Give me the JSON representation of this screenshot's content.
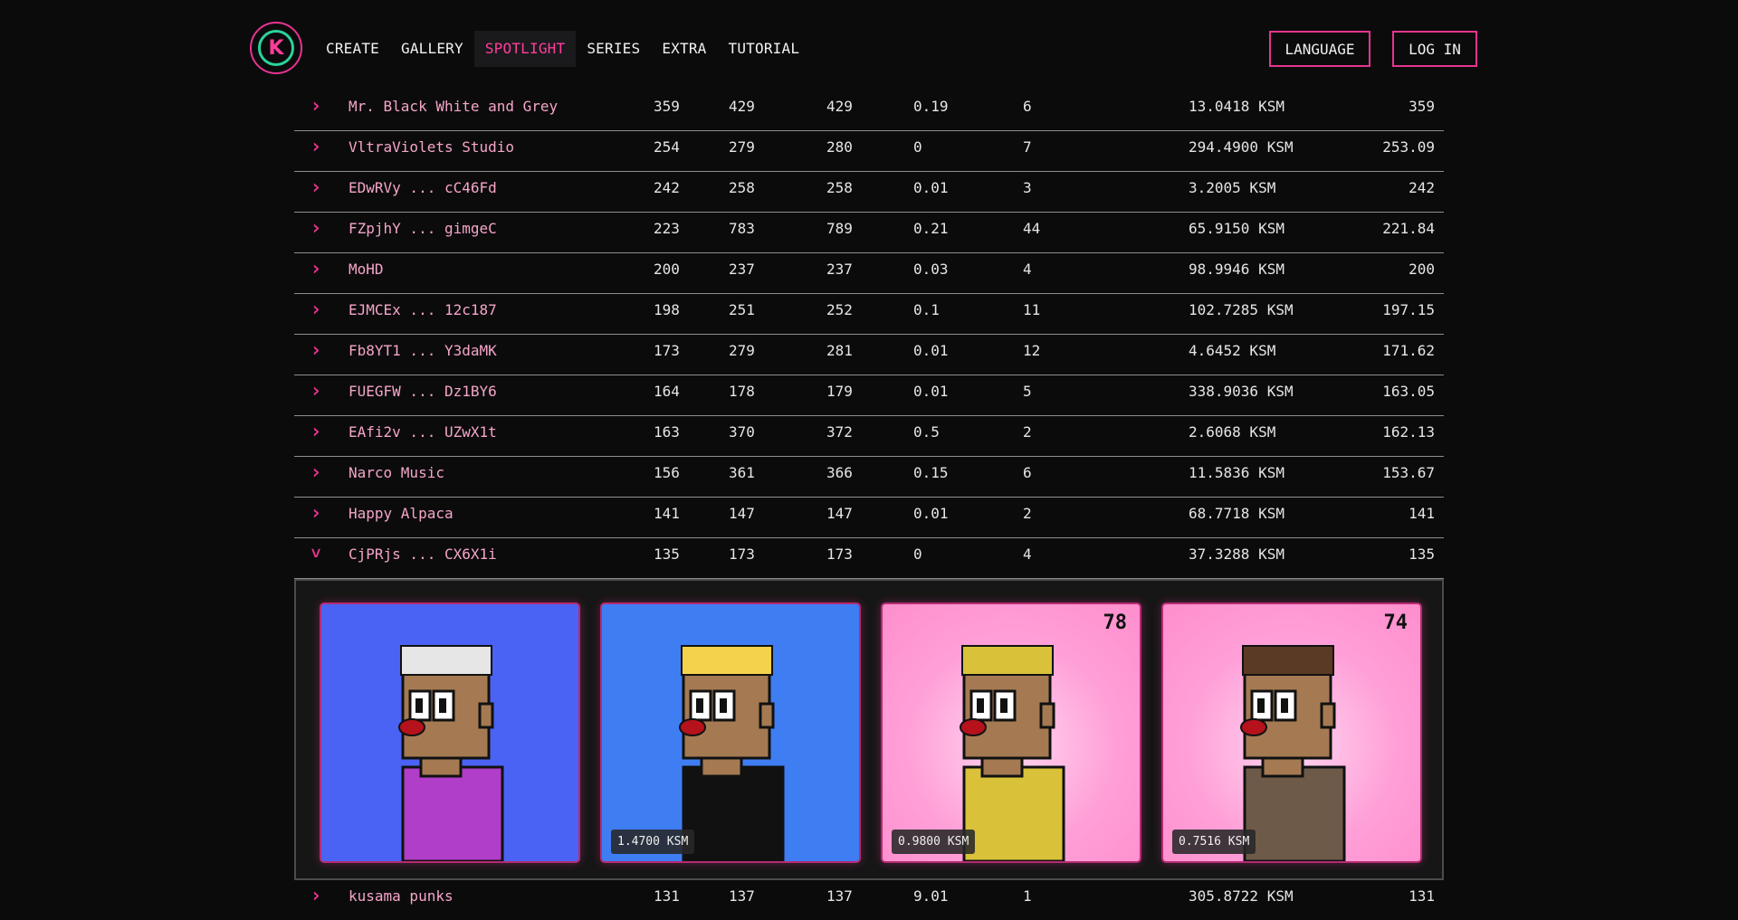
{
  "header": {
    "logo_letter": "K",
    "nav": [
      {
        "label": "CREATE",
        "active": false
      },
      {
        "label": "GALLERY",
        "active": false
      },
      {
        "label": "SPOTLIGHT",
        "active": true
      },
      {
        "label": "SERIES",
        "active": false
      },
      {
        "label": "EXTRA",
        "active": false
      },
      {
        "label": "TUTORIAL",
        "active": false
      }
    ],
    "language_label": "LANGUAGE",
    "login_label": "LOG IN"
  },
  "rows": [
    {
      "name": "Mr. Black White and Grey",
      "a": "359",
      "b": "429",
      "c": "429",
      "d": "0.19",
      "e": "6",
      "f": "13.0418 KSM",
      "g": "359",
      "expanded": false
    },
    {
      "name": "VltraViolets Studio",
      "a": "254",
      "b": "279",
      "c": "280",
      "d": "0",
      "e": "7",
      "f": "294.4900 KSM",
      "g": "253.09",
      "expanded": false
    },
    {
      "name": "EDwRVy ... cC46Fd",
      "a": "242",
      "b": "258",
      "c": "258",
      "d": "0.01",
      "e": "3",
      "f": "3.2005 KSM",
      "g": "242",
      "expanded": false
    },
    {
      "name": "FZpjhY ... gimgeC",
      "a": "223",
      "b": "783",
      "c": "789",
      "d": "0.21",
      "e": "44",
      "f": "65.9150 KSM",
      "g": "221.84",
      "expanded": false
    },
    {
      "name": "MoHD",
      "a": "200",
      "b": "237",
      "c": "237",
      "d": "0.03",
      "e": "4",
      "f": "98.9946 KSM",
      "g": "200",
      "expanded": false
    },
    {
      "name": "EJMCEx ... 12c187",
      "a": "198",
      "b": "251",
      "c": "252",
      "d": "0.1",
      "e": "11",
      "f": "102.7285 KSM",
      "g": "197.15",
      "expanded": false
    },
    {
      "name": "Fb8YT1 ... Y3daMK",
      "a": "173",
      "b": "279",
      "c": "281",
      "d": "0.01",
      "e": "12",
      "f": "4.6452 KSM",
      "g": "171.62",
      "expanded": false
    },
    {
      "name": "FUEGFW ... Dz1BY6",
      "a": "164",
      "b": "178",
      "c": "179",
      "d": "0.01",
      "e": "5",
      "f": "338.9036 KSM",
      "g": "163.05",
      "expanded": false
    },
    {
      "name": "EAfi2v ... UZwX1t",
      "a": "163",
      "b": "370",
      "c": "372",
      "d": "0.5",
      "e": "2",
      "f": "2.6068 KSM",
      "g": "162.13",
      "expanded": false
    },
    {
      "name": "Narco Music",
      "a": "156",
      "b": "361",
      "c": "366",
      "d": "0.15",
      "e": "6",
      "f": "11.5836 KSM",
      "g": "153.67",
      "expanded": false
    },
    {
      "name": "Happy Alpaca",
      "a": "141",
      "b": "147",
      "c": "147",
      "d": "0.01",
      "e": "2",
      "f": "68.7718 KSM",
      "g": "141",
      "expanded": false
    },
    {
      "name": "CjPRjs ... CX6X1i",
      "a": "135",
      "b": "173",
      "c": "173",
      "d": "0",
      "e": "4",
      "f": "37.3288 KSM",
      "g": "135",
      "expanded": true
    }
  ],
  "expanded_items": [
    {
      "variant": "blue1",
      "price": "",
      "rank": "",
      "hair": "#e6e6e6",
      "shirt": "#b03ec8"
    },
    {
      "variant": "blue2",
      "price": "1.4700 KSM",
      "rank": "",
      "hair": "#f4d24b",
      "shirt": "#111111"
    },
    {
      "variant": "pink",
      "price": "0.9800 KSM",
      "rank": "78",
      "hair": "#d9c23a",
      "shirt": "#d9c23a"
    },
    {
      "variant": "pink",
      "price": "0.7516 KSM",
      "rank": "74",
      "hair": "#5a3a24",
      "shirt": "#6e5a48"
    }
  ],
  "last_row": {
    "name": "kusama punks",
    "a": "131",
    "b": "137",
    "c": "137",
    "d": "9.01",
    "e": "1",
    "f": "305.8722 KSM",
    "g": "131"
  }
}
